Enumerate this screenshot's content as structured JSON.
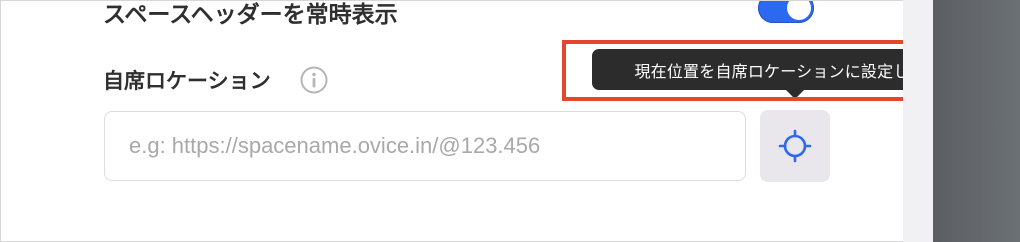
{
  "previous_setting": {
    "label": "スペースヘッダーを常時表示",
    "toggle_on": true
  },
  "self_seat_location": {
    "title": "自席ロケーション",
    "info_icon": "info-circle-icon",
    "input_placeholder": "e.g: https://spacename.ovice.in/@123.456",
    "input_value": "",
    "locate_button_icon": "crosshair-locate-icon",
    "tooltip": "現在位置を自席ロケーションに設定します。"
  },
  "colors": {
    "accent_blue": "#2d69f0",
    "tooltip_bg": "#2c2c2c",
    "highlight_red": "#e4472d",
    "button_bg": "#e9e6ec"
  }
}
